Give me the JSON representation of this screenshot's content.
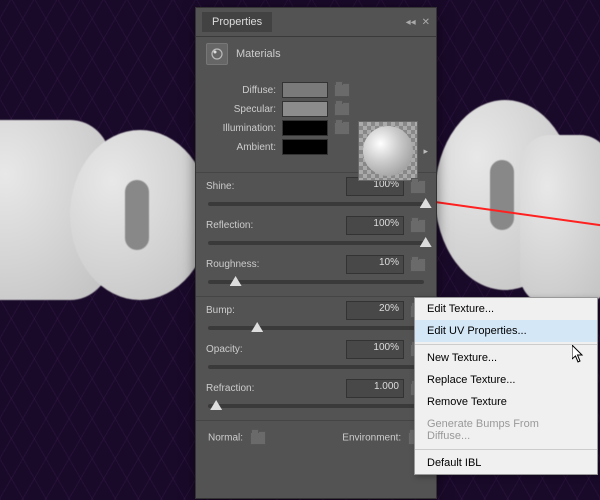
{
  "panel": {
    "title": "Properties",
    "subtitle": "Materials"
  },
  "props": {
    "diffuse": {
      "label": "Diffuse:",
      "color": "#7a7a7a"
    },
    "specular": {
      "label": "Specular:",
      "color": "#8c8c8c"
    },
    "illumination": {
      "label": "Illumination:",
      "color": "#000000"
    },
    "ambient": {
      "label": "Ambient:",
      "color": "#000000"
    }
  },
  "sliders": [
    {
      "label": "Shine:",
      "value": "100%",
      "pos": 98
    },
    {
      "label": "Reflection:",
      "value": "100%",
      "pos": 98
    },
    {
      "label": "Roughness:",
      "value": "10%",
      "pos": 10
    },
    {
      "label": "Bump:",
      "value": "20%",
      "pos": 20
    },
    {
      "label": "Opacity:",
      "value": "100%",
      "pos": 98
    },
    {
      "label": "Refraction:",
      "value": "1.000",
      "pos": 1
    }
  ],
  "bottom": {
    "normal": "Normal:",
    "env": "Environment:"
  },
  "menu": {
    "items": [
      {
        "label": "Edit Texture...",
        "type": "n"
      },
      {
        "label": "Edit UV Properties...",
        "type": "hl"
      },
      {
        "label": "New Texture...",
        "type": "n",
        "sep": true
      },
      {
        "label": "Replace Texture...",
        "type": "n"
      },
      {
        "label": "Remove Texture",
        "type": "n"
      },
      {
        "label": "Generate Bumps From Diffuse...",
        "type": "dis"
      },
      {
        "label": "Default IBL",
        "type": "n",
        "sep": true
      }
    ]
  }
}
